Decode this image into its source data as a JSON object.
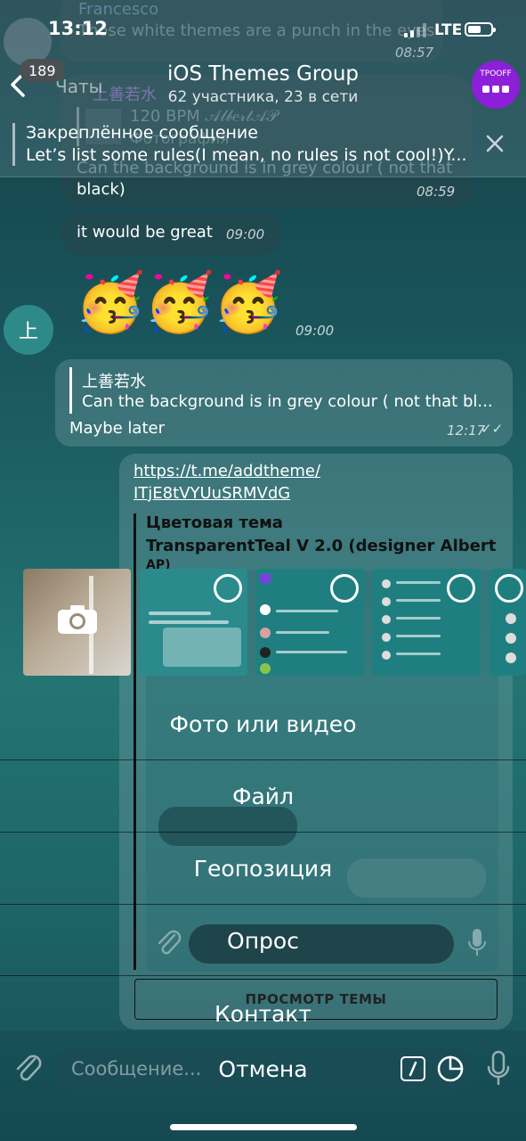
{
  "status_bar": {
    "time": "13:12",
    "network": "LTE"
  },
  "header": {
    "back_label": "Чаты",
    "unread_badge": "189",
    "title": "iOS Themes Group",
    "subtitle": "62 участника, 23 в сети",
    "avatar_text": "TPOOFF"
  },
  "pinned": {
    "title": "Закреплённое сообщение",
    "text": "Let’s list some rules(I mean, no rules is not cool!)Y..."
  },
  "messages": {
    "m1_sender": "Francesco",
    "m1_text": "Those white themes are a punch in the eyes",
    "m1_time": "08:57",
    "m2_sender": "上善若水",
    "m2_reply_title": "120 BPM 𝒜𝓁𝒷𝑒𝓇𝓉𝒜𝒫",
    "m2_reply_sub": "Фотография",
    "m2_text1": "Can the background is in grey colour ( not that",
    "m2_text2": "black)",
    "m2_time": "08:59",
    "m3_text": "it would be great",
    "m3_time": "09:00",
    "emoji": "🥳🥳🥳",
    "m4_time": "09:00",
    "user_avatar": "上",
    "m5_reply_name": "上善若水",
    "m5_reply_text": "Can the background is in grey colour ( not that bl...",
    "m5_text": "Maybe later",
    "m5_time": "12:17",
    "link_line1": "https://t.me/addtheme/",
    "link_line2": "ITjE8tVYUuSRMVdG",
    "preview_title": "Цветовая тема",
    "preview_sub": "TransparentTeal V 2.0 (designer Albert",
    "preview_sub2": "AP)",
    "view_theme": "ПРОСМОТР ТЕМЫ"
  },
  "attach_menu": {
    "photo_video": "Фото или видео",
    "file": "Файл",
    "location": "Геопозиция",
    "poll": "Опрос",
    "contact": "Контакт",
    "cancel": "Отмена"
  },
  "input": {
    "placeholder": "Сообщение..."
  }
}
